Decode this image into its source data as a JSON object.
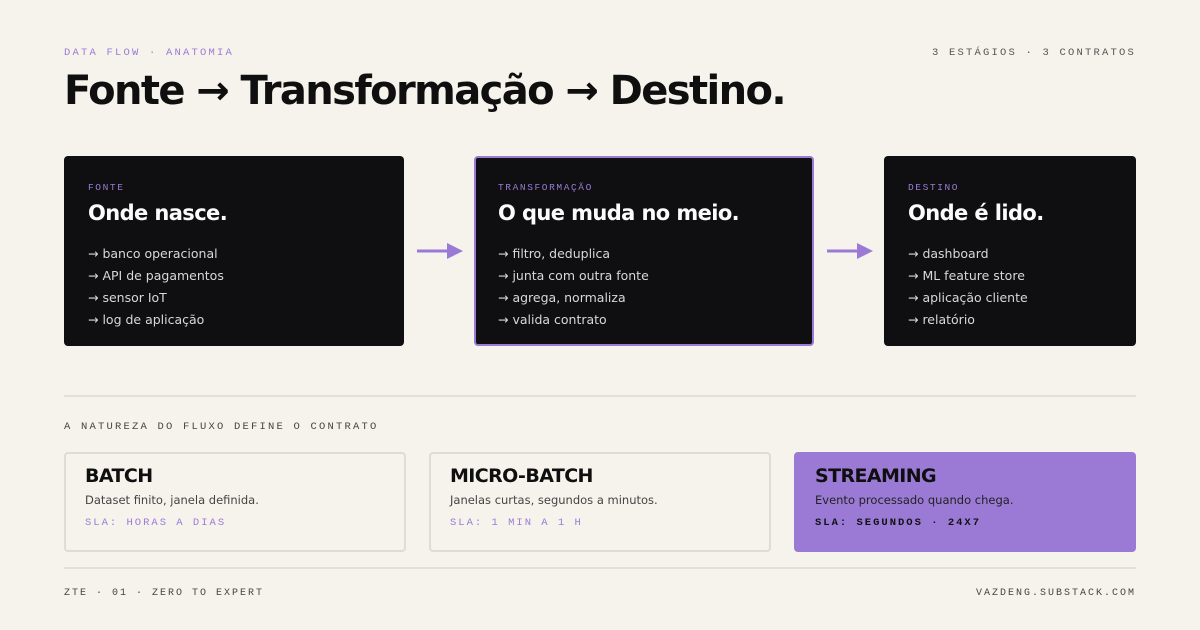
{
  "header": {
    "kicker": "DATA FLOW · ANATOMIA",
    "meta": "3 ESTÁGIOS · 3 CONTRATOS",
    "title": "Fonte → Transformação → Destino."
  },
  "stages": [
    {
      "tag": "FONTE",
      "heading": "Onde nasce.",
      "items": [
        "→ banco operacional",
        "→ API de pagamentos",
        "→ sensor IoT",
        "→ log de aplicação"
      ]
    },
    {
      "tag": "TRANSFORMAÇÃO",
      "heading": "O que muda no meio.",
      "items": [
        "→ filtro, deduplica",
        "→ junta com outra fonte",
        "→ agrega, normaliza",
        "→ valida contrato"
      ]
    },
    {
      "tag": "DESTINO",
      "heading": "Onde é lido.",
      "items": [
        "→ dashboard",
        "→ ML feature store",
        "→ aplicação cliente",
        "→ relatório"
      ]
    }
  ],
  "section_label": "A NATUREZA DO FLUXO DEFINE O CONTRATO",
  "modes": [
    {
      "name": "BATCH",
      "desc": "Dataset finito, janela definida.",
      "sla": "SLA: HORAS A DIAS"
    },
    {
      "name": "MICRO-BATCH",
      "desc": "Janelas curtas, segundos a minutos.",
      "sla": "SLA: 1 MIN A 1 H"
    },
    {
      "name": "STREAMING",
      "desc": "Evento processado quando chega.",
      "sla": "SLA: SEGUNDOS · 24X7"
    }
  ],
  "footer": {
    "left": "ZTE · 01 · ZERO TO EXPERT",
    "right": "VAZDENG.SUBSTACK.COM"
  },
  "colors": {
    "background": "#f6f3ec",
    "accent": "#9b7ad6",
    "card_dark": "#0f0f11"
  }
}
